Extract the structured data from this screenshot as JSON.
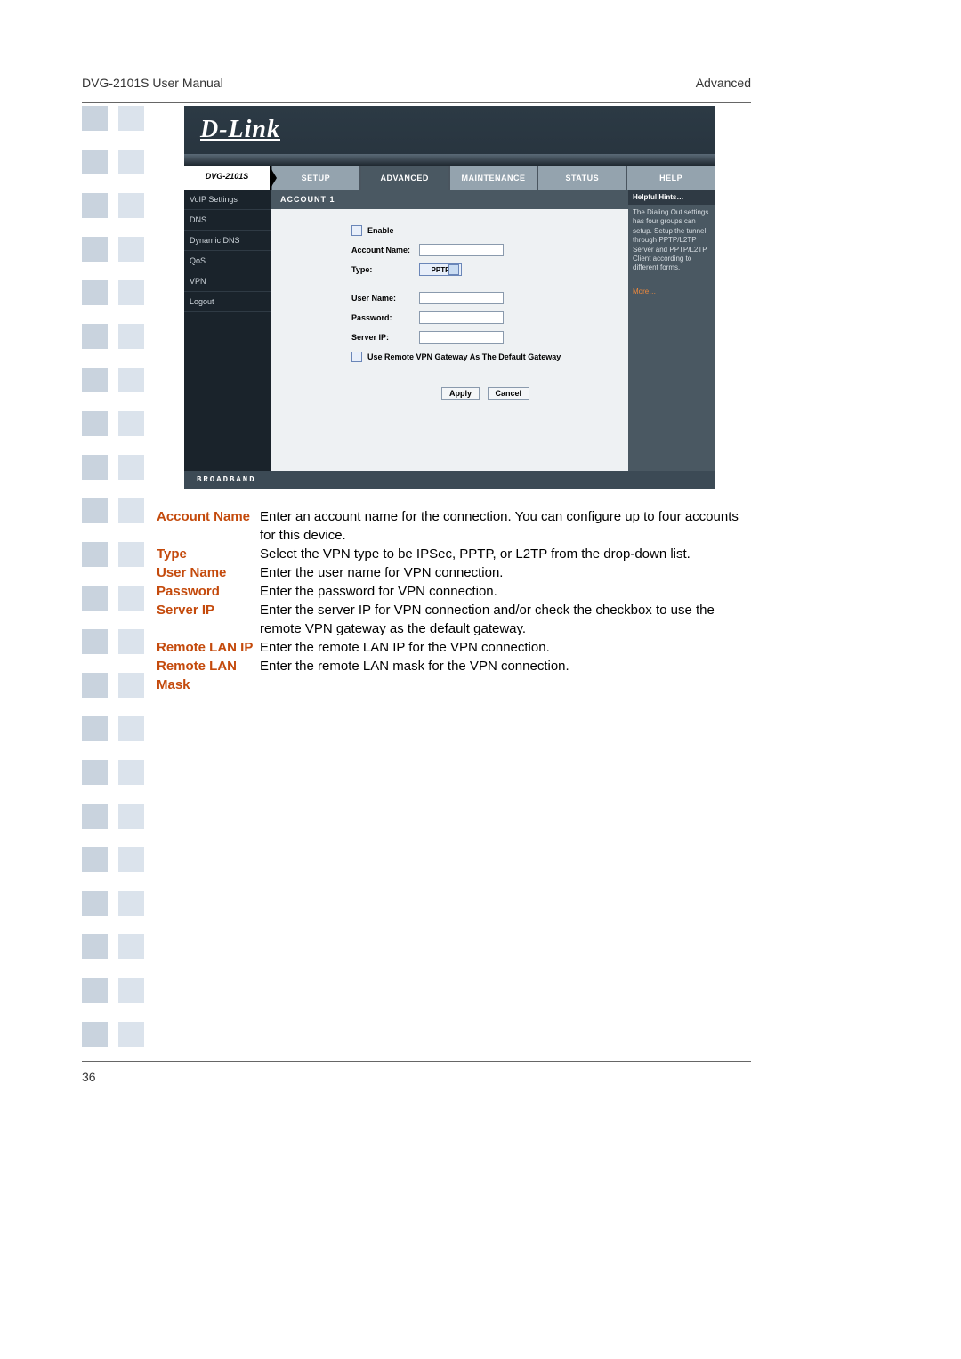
{
  "header": {
    "left": "DVG-2101S User Manual",
    "right": "Advanced"
  },
  "page_number": "36",
  "router": {
    "logo": "D-Link",
    "device": "DVG-2101S",
    "tabs": [
      "SETUP",
      "ADVANCED",
      "MAINTENANCE",
      "STATUS",
      "HELP"
    ],
    "active_tab": "ADVANCED",
    "sidebar": [
      "VoIP Settings",
      "DNS",
      "Dynamic DNS",
      "QoS",
      "VPN",
      "Logout"
    ],
    "section_title": "ACCOUNT 1",
    "form": {
      "enable_label": "Enable",
      "account_name_label": "Account Name:",
      "type_label": "Type:",
      "type_value": "PPTP",
      "user_name_label": "User Name:",
      "password_label": "Password:",
      "server_ip_label": "Server IP:",
      "gateway_checkbox_label": "Use Remote VPN Gateway As The Default Gateway",
      "apply": "Apply",
      "cancel": "Cancel"
    },
    "help": {
      "title": "Helpful Hints…",
      "body": "The Dialing Out settings has four groups can setup. Setup the tunnel through PPTP/L2TP Server and PPTP/L2TP Client according to different forms.",
      "more": "More…"
    },
    "footer": "BROADBAND"
  },
  "descriptions": [
    {
      "term": "Account Name",
      "def": "Enter an account name for the connection. You can configure up to four accounts for this device."
    },
    {
      "term": "Type",
      "def": "Select the VPN type to be IPSec, PPTP, or L2TP from the drop-down list."
    },
    {
      "term": "User Name",
      "def": "Enter the user name for VPN connection."
    },
    {
      "term": "Password",
      "def": "Enter the password for VPN connection."
    },
    {
      "term": "Server IP",
      "def": "Enter the server IP for VPN connection and/or check the checkbox to use the remote VPN gateway as the default gateway."
    },
    {
      "term": "Remote LAN IP",
      "def": "Enter the remote LAN IP for the VPN connection."
    },
    {
      "term": "Remote LAN Mask",
      "def": "Enter the remote LAN mask for the VPN connection."
    }
  ]
}
